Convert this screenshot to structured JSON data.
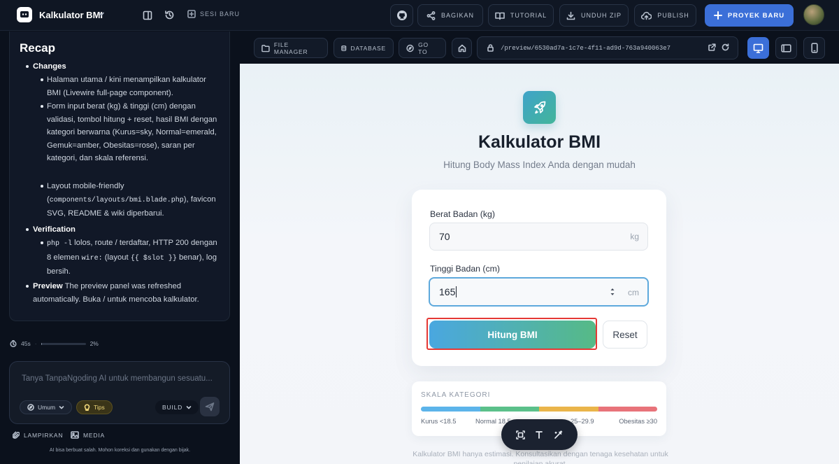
{
  "app": {
    "title": "Kalkulator BMI",
    "sesi_baru": "SESI BARU"
  },
  "header_actions": {
    "bagikan": "BAGIKAN",
    "tutorial": "TUTORIAL",
    "unduh_zip": "UNDUH ZIP",
    "publish": "PUBLISH",
    "proyek_baru": "PROYEK BARU"
  },
  "recap": {
    "title": "Recap",
    "changes_label": "Changes",
    "changes_items": [
      "Halaman utama / kini menampilkan kalkulator BMI (Livewire full-page component).",
      "Form input berat (kg) & tinggi (cm) dengan validasi, tombol hitung + reset, hasil BMI dengan kategori berwarna (Kurus=sky, Normal=emerald, Gemuk=amber, Obesitas=rose), saran per kategori, dan skala referensi."
    ],
    "layout_pre": "Layout mobile-friendly (",
    "layout_code": "components/layouts/bmi.blade.php",
    "layout_post": "), favicon SVG, README & wiki diperbarui.",
    "verification_label": "Verification",
    "verif_code1": "php -l",
    "verif_text1": " lolos, route / terdaftar, HTTP 200 dengan 8 elemen ",
    "verif_code2": "wire:",
    "verif_text2": " (layout ",
    "verif_code3": "{{ $slot }}",
    "verif_text3": " benar), log bersih.",
    "preview_label": "Preview",
    "preview_text": " The preview panel was refreshed automatically. Buka / untuk mencoba kalkulator."
  },
  "status": {
    "time": "45s",
    "percent": "2%",
    "progress": 0.02
  },
  "chat": {
    "placeholder": "Tanya TanpaNgoding AI untuk membangun sesuatu...",
    "mode": "Umum",
    "tips": "Tips",
    "build": "BUILD",
    "lampirkan": "LAMPIRKAN",
    "media": "MEDIA",
    "disclaimer": "AI bisa berbuat salah. Mohon koreksi dan gunakan dengan bijak."
  },
  "preview_toolbar": {
    "file_manager": "FILE MANAGER",
    "database": "DATABASE",
    "go_to": "GO TO",
    "url": "/preview/6530ad7a-1c7e-4f11-ad9d-763a940063e7"
  },
  "bmi": {
    "title": "Kalkulator BMI",
    "subtitle": "Hitung Body Mass Index Anda dengan mudah",
    "berat_label": "Berat Badan (kg)",
    "berat_value": "70",
    "berat_unit": "kg",
    "tinggi_label": "Tinggi Badan (cm)",
    "tinggi_value": "165",
    "tinggi_unit": "cm",
    "hitung": "Hitung BMI",
    "reset": "Reset",
    "skala_title": "SKALA KATEGORI",
    "skala_labels": [
      "Kurus <18.5",
      "Normal 18.5",
      "25–29.9",
      "Obesitas ≥30"
    ],
    "skala_colors": [
      "#5cb4ea",
      "#5bc08a",
      "#eab54a",
      "#e8737a"
    ],
    "footer": "Kalkulator BMI hanya estimasi. Konsultasikan dengan tenaga kesehatan untuk penilaian akurat."
  }
}
